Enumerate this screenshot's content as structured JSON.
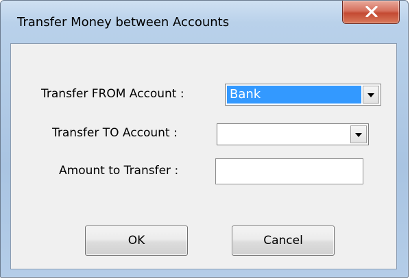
{
  "window": {
    "title": "Transfer Money between Accounts"
  },
  "form": {
    "from_label": "Transfer FROM Account :",
    "from_value": "Bank",
    "to_label": "Transfer TO Account :",
    "to_value": "",
    "amount_label": "Amount to Transfer :",
    "amount_value": ""
  },
  "buttons": {
    "ok_label": "OK",
    "cancel_label": "Cancel"
  },
  "colors": {
    "selection_highlight": "#3399ff",
    "close_button": "#c44a33",
    "frame": "#b9d1ea"
  },
  "icons": {
    "close": "close-icon",
    "dropdown": "chevron-down-icon"
  }
}
